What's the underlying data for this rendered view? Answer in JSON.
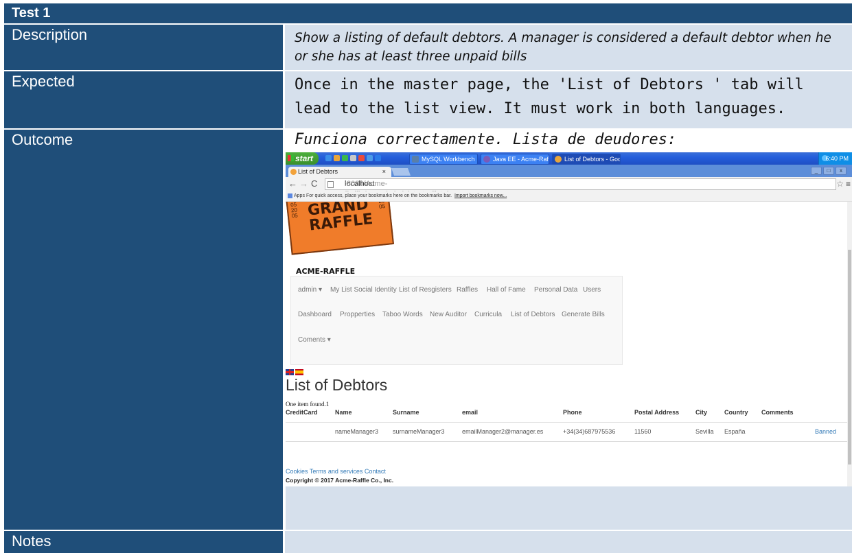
{
  "header": {
    "title": "Test 1"
  },
  "rows": {
    "description": {
      "label": "Description",
      "text": "Show a listing of default debtors. A manager is considered a default debtor when he or she has at least three unpaid bills"
    },
    "expected": {
      "label": "Expected",
      "text": "Once in the master page, the 'List of Debtors ' tab will lead to the list view. It must work in both languages."
    },
    "outcome": {
      "label": "Outcome",
      "text": "Funciona correctamente. Lista de deudores:"
    },
    "notes": {
      "label": "Notes",
      "text": ""
    }
  },
  "colors": {
    "label_bg": "#1f4e79",
    "value_bg": "#d6e0ec",
    "link": "#337ab7"
  },
  "screenshot": {
    "taskbar": {
      "start_label": "start",
      "tasks": [
        {
          "label": "MySQL Workbench",
          "icon": "mysql-icon"
        },
        {
          "label": "Java EE - Acme-Raffl...",
          "icon": "eclipse-icon"
        },
        {
          "label": "List of Debtors - Goo...",
          "icon": "chrome-icon"
        }
      ],
      "clock": "6:40 PM"
    },
    "browser": {
      "tab_title": "List of Debtors",
      "tab_close": "×",
      "url_host": "localhost",
      "url_rest": ":8080/Acme-Raffle/mana/administrator/list.do",
      "bookmarks_apps": "Apps",
      "bookmarks_hint": "For quick access, place your bookmarks here on the bookmarks bar.",
      "bookmarks_import": "Import bookmarks now...",
      "win_min": "_",
      "win_max": "□",
      "win_close": "x"
    },
    "logo": {
      "line1": "GRAND",
      "line2": "RAFFLE",
      "serial": "052005"
    },
    "brand": "ACME-RAFFLE",
    "nav": {
      "row1": [
        "admin ▾",
        "My List Social Identity",
        "List of Resgisters",
        "Raffles",
        "Hall of Fame",
        "Personal Data",
        "Users"
      ],
      "row2": [
        "Dashboard",
        "Propperties",
        "Taboo Words",
        "New Auditor",
        "Curricula",
        "List of Debtors",
        "Generate Bills"
      ],
      "row3": [
        "Coments ▾"
      ]
    },
    "heading": "List of Debtors",
    "found": "One item found.1",
    "table": {
      "headers": [
        "CreditCard",
        "Name",
        "Surname",
        "email",
        "Phone",
        "Postal Address",
        "City",
        "Country",
        "Comments"
      ],
      "rows": [
        [
          "",
          "nameManager3",
          "surnameManager3",
          "emailManager2@manager.es",
          "+34(34)687975536",
          "11560",
          "Sevilla",
          "España",
          "",
          "Banned"
        ]
      ]
    },
    "footer": {
      "links": "Cookies Terms and services Contact",
      "copyright": "Copyright © 2017 Acme-Raffle Co., Inc."
    }
  }
}
